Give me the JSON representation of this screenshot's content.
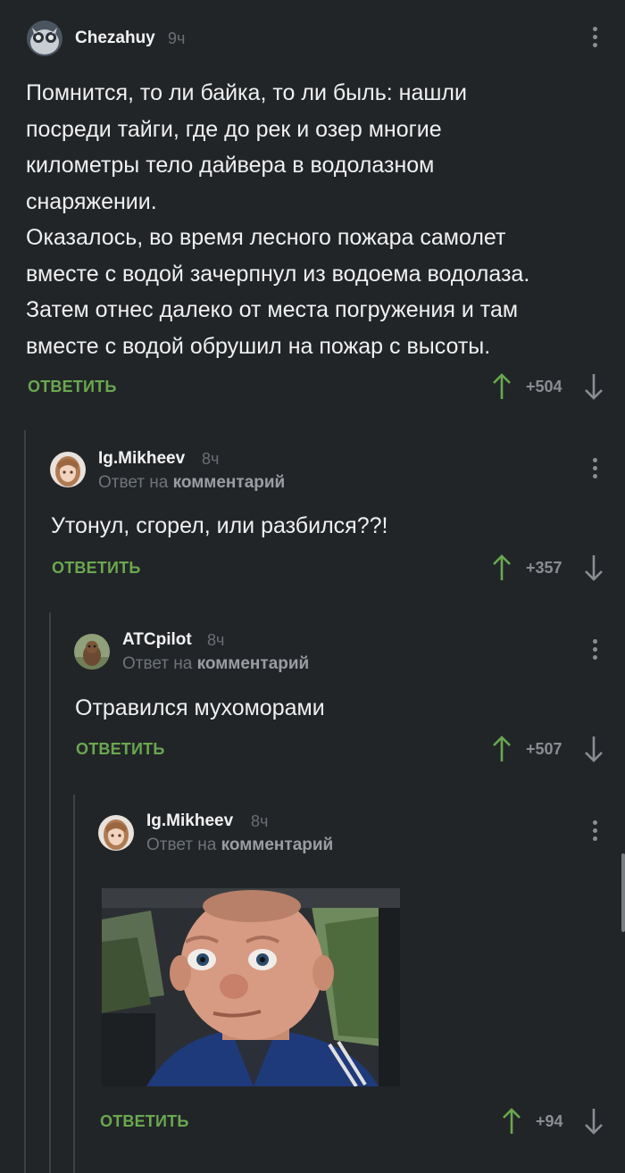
{
  "comments": [
    {
      "username": "Chezahuy",
      "time": "9ч",
      "text": "Помнится, то ли байка, то ли быль: нашли\nпосреди тайги, где до рек и озер многие\nкилометры тело дайвера в водолазном\nснаряжении.\nОказалось, во время лесного пожара самолет\nвместе с водой зачерпнул из водоема водолаза.\nЗатем отнес далеко от места погружения и там\nвместе с водой обрушил на пожар с высоты.",
      "reply_label": "ОТВЕТИТЬ",
      "score": "+504"
    },
    {
      "username": "Ig.Mikheev",
      "time": "8ч",
      "reply_prefix": "Ответ на",
      "reply_target": "комментарий",
      "text": "Утонул, сгорел, или разбился??!",
      "reply_label": "ОТВЕТИТЬ",
      "score": "+357"
    },
    {
      "username": "ATCpilot",
      "time": "8ч",
      "reply_prefix": "Ответ на",
      "reply_target": "комментарий",
      "text": "Отравился мухоморами",
      "reply_label": "ОТВЕТИТЬ",
      "score": "+507"
    },
    {
      "username": "Ig.Mikheev",
      "time": "8ч",
      "reply_prefix": "Ответ на",
      "reply_target": "комментарий",
      "reply_label": "ОТВЕТИТЬ",
      "score": "+94"
    }
  ],
  "colors": {
    "background": "#222528",
    "reply_button": "#6aa84f",
    "vote_up": "#6aa84f",
    "vote_down": "#8a8e92",
    "thread_line": "#3d4145"
  },
  "icons": [
    "owl-avatar",
    "anime-girl-avatar",
    "animal-avatar",
    "kebab-menu-icon",
    "arrow-up-icon",
    "arrow-down-icon"
  ]
}
